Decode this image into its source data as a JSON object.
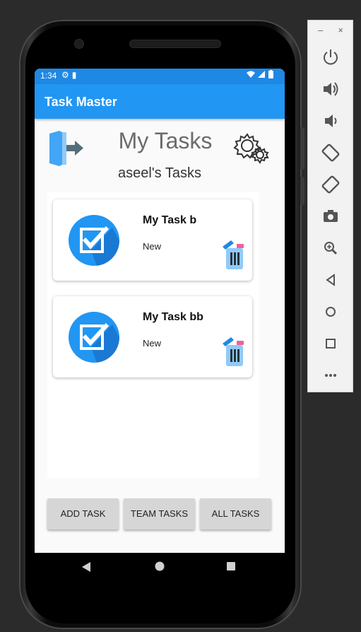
{
  "status_bar": {
    "time": "1:34"
  },
  "app_bar": {
    "title": "Task Master"
  },
  "header": {
    "page_title": "My Tasks",
    "user_tasks": "aseel's Tasks"
  },
  "tasks": [
    {
      "title": "My Task b",
      "state": "New"
    },
    {
      "title": "My Task bb",
      "state": "New"
    }
  ],
  "buttons": {
    "add_task": "ADD TASK",
    "team_tasks": "TEAM TASKS",
    "all_tasks": "ALL TASKS"
  },
  "colors": {
    "app_bar": "#2196f3",
    "status_bar": "#1e88e5",
    "check_circle": "#2196f3",
    "button": "#d6d6d6"
  },
  "icons": [
    "logout-icon",
    "settings-icon",
    "task-check-icon",
    "trash-icon"
  ],
  "emulator_toolbar": {
    "minimize": "–",
    "close": "×",
    "tools": [
      "power",
      "volume-up",
      "volume-down",
      "rotate-left",
      "rotate-right",
      "screenshot",
      "zoom",
      "back",
      "home",
      "overview",
      "more"
    ]
  }
}
